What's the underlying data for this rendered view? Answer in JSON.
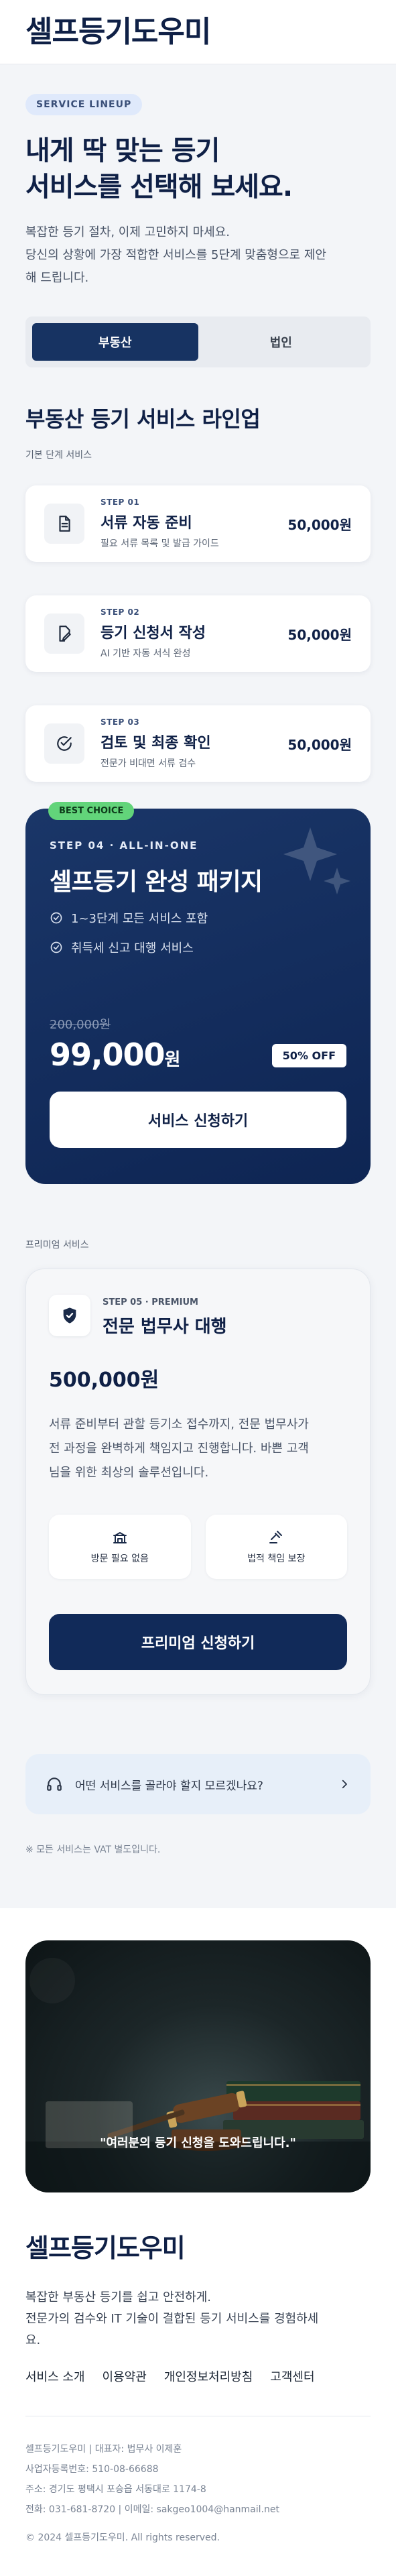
{
  "header": {
    "logo": "셀프등기도우미"
  },
  "hero": {
    "badge": "SERVICE LINEUP",
    "title_line1": "내게 딱 맞는 등기",
    "title_line2": "서비스를 선택해 보세요.",
    "desc_line1": "복잡한 등기 절차, 이제 고민하지 마세요.",
    "desc_line2": "당신의 상황에 가장 적합한 서비스를 5단계 맞춤형으로 제안",
    "desc_line3": "해 드립니다."
  },
  "tabs": [
    {
      "label": "부동산",
      "active": true
    },
    {
      "label": "법인",
      "active": false
    }
  ],
  "lineup": {
    "title": "부동산 등기 서비스 라인업",
    "subtitle": "기본 단계 서비스",
    "steps": [
      {
        "label": "STEP 01",
        "name": "서류 자동 준비",
        "desc": "필요 서류 목록 및 발급 가이드",
        "price": "50,000원",
        "icon": "document-icon"
      },
      {
        "label": "STEP 02",
        "name": "등기 신청서 작성",
        "desc": "AI 기반 자동 서식 완성",
        "price": "50,000원",
        "icon": "edit-document-icon"
      },
      {
        "label": "STEP 03",
        "name": "검토 및 최종 확인",
        "desc": "전문가 비대면 서류 검수",
        "price": "50,000원",
        "icon": "check-circle-icon"
      }
    ]
  },
  "package": {
    "badge": "BEST CHOICE",
    "step": "STEP 04 · ALL-IN-ONE",
    "title": "셀프등기 완성 패키지",
    "features": [
      "1~3단계 모든 서비스 포함",
      "취득세 신고 대행 서비스"
    ],
    "old_price": "200,000원",
    "price": "99,000",
    "price_unit": "원",
    "discount": "50% OFF",
    "button": "서비스 신청하기"
  },
  "premium": {
    "section_label": "프리미엄 서비스",
    "step": "STEP 05 · PREMIUM",
    "name": "전문 법무사 대행",
    "price": "500,000원",
    "desc_line1": "서류 준비부터 관할 등기소 접수까지, 전문 법무사가",
    "desc_line2": "전 과정을 완벽하게 책임지고 진행합니다. 바쁜 고객",
    "desc_line3": "님을 위한 최상의 솔루션입니다.",
    "features": [
      {
        "label": "방문 필요 없음",
        "icon": "building-icon"
      },
      {
        "label": "법적 책임 보장",
        "icon": "gavel-icon"
      }
    ],
    "button": "프리미엄 신청하기"
  },
  "help": {
    "text": "어떤 서비스를 골라야 할지 모르겠나요?"
  },
  "vat_note": "※ 모든 서비스는 VAT 별도입니다.",
  "footer": {
    "quote": "\"여러분의 등기 신청을 도와드립니다.\"",
    "logo": "셀프등기도우미",
    "desc_line1": "복잡한 부동산 등기를 쉽고 안전하게.",
    "desc_line2": "전문가의 검수와 IT 기술이 결합된 등기 서비스를 경험하세",
    "desc_line3": "요.",
    "links": [
      "서비스 소개",
      "이용약관",
      "개인정보처리방침",
      "고객센터"
    ],
    "info_line1": "셀프등기도우미 | 대표자: 법무사 이제훈",
    "info_line2": "사업자등록번호: 510-08-66688",
    "info_line3": "주소: 경기도 평택시 포승읍 서동대로 1174-8",
    "info_line4": "전화: 031-681-8720 | 이메일: sakgeo1004@hanmail.net",
    "copyright": "© 2024 셀프등기도우미. All rights reserved."
  },
  "colors": {
    "navy": "#0f2046",
    "package_bg": "#173362",
    "best_choice_green": "#62d47a",
    "page_bg": "#f3f5f8",
    "help_bg": "#e7eff9"
  }
}
